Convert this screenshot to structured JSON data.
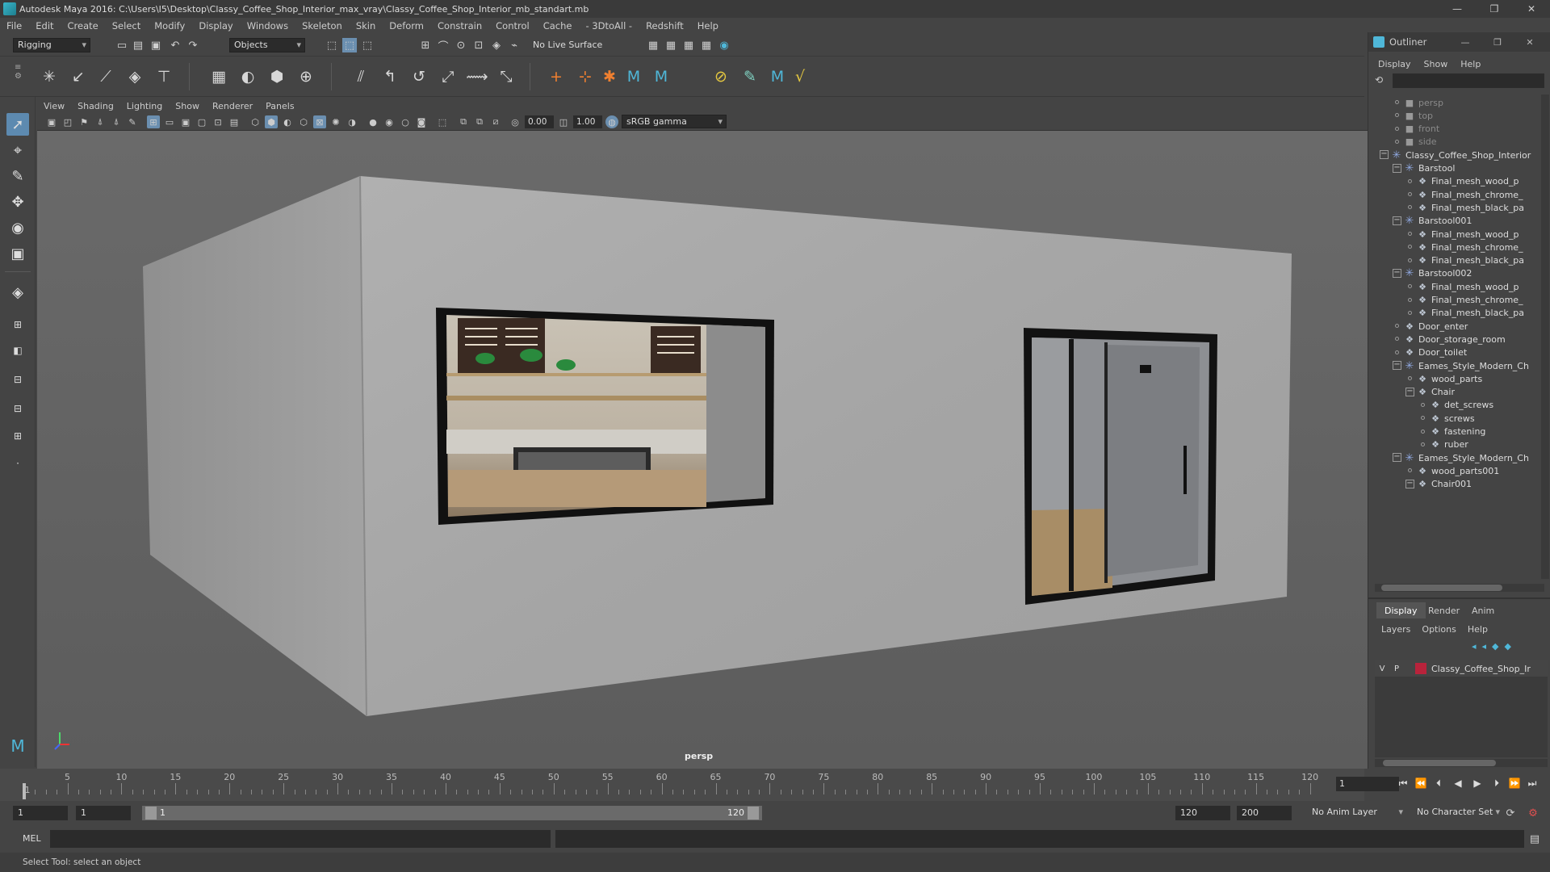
{
  "window": {
    "title": "Autodesk Maya 2016: C:\\Users\\I5\\Desktop\\Classy_Coffee_Shop_Interior_max_vray\\Classy_Coffee_Shop_Interior_mb_standart.mb",
    "minimize": "—",
    "restore": "❐",
    "close": "✕"
  },
  "menubar": [
    "File",
    "Edit",
    "Create",
    "Select",
    "Modify",
    "Display",
    "Windows",
    "Skeleton",
    "Skin",
    "Deform",
    "Constrain",
    "Control",
    "Cache",
    "- 3DtoAll -",
    "Redshift",
    "Help"
  ],
  "statusline": {
    "menuset": "Rigging",
    "selection_mask": "Objects",
    "live_surface": "No Live Surface"
  },
  "viewport": {
    "menu": [
      "View",
      "Shading",
      "Lighting",
      "Show",
      "Renderer",
      "Panels"
    ],
    "exposure": "0.00",
    "gamma": "1.00",
    "color_space": "sRGB gamma",
    "camera_label": "persp",
    "colors": {
      "wall": "#a8a8a8",
      "wall_side": "#9a9a9a",
      "window_frame": "#111111",
      "bg": "#616161"
    }
  },
  "outliner": {
    "title": "Outliner",
    "menu": [
      "Display",
      "Show",
      "Help"
    ],
    "items": [
      {
        "label": "persp",
        "type": "camera"
      },
      {
        "label": "top",
        "type": "camera"
      },
      {
        "label": "front",
        "type": "camera"
      },
      {
        "label": "side",
        "type": "camera"
      },
      {
        "label": "Classy_Coffee_Shop_Interior",
        "type": "group"
      },
      {
        "label": "Barstool",
        "type": "group"
      },
      {
        "label": "Final_mesh_wood_p",
        "type": "mesh"
      },
      {
        "label": "Final_mesh_chrome_",
        "type": "mesh"
      },
      {
        "label": "Final_mesh_black_pa",
        "type": "mesh"
      },
      {
        "label": "Barstool001",
        "type": "group"
      },
      {
        "label": "Final_mesh_wood_p",
        "type": "mesh"
      },
      {
        "label": "Final_mesh_chrome_",
        "type": "mesh"
      },
      {
        "label": "Final_mesh_black_pa",
        "type": "mesh"
      },
      {
        "label": "Barstool002",
        "type": "group"
      },
      {
        "label": "Final_mesh_wood_p",
        "type": "mesh"
      },
      {
        "label": "Final_mesh_chrome_",
        "type": "mesh"
      },
      {
        "label": "Final_mesh_black_pa",
        "type": "mesh"
      },
      {
        "label": "Door_enter",
        "type": "mesh"
      },
      {
        "label": "Door_storage_room",
        "type": "mesh"
      },
      {
        "label": "Door_toilet",
        "type": "mesh"
      },
      {
        "label": "Eames_Style_Modern_Ch",
        "type": "group"
      },
      {
        "label": "wood_parts",
        "type": "mesh"
      },
      {
        "label": "Chair",
        "type": "mesh"
      },
      {
        "label": "det_screws",
        "type": "mesh"
      },
      {
        "label": "screws",
        "type": "mesh"
      },
      {
        "label": "fastening",
        "type": "mesh"
      },
      {
        "label": "ruber",
        "type": "mesh"
      },
      {
        "label": "Eames_Style_Modern_Ch",
        "type": "group"
      },
      {
        "label": "wood_parts001",
        "type": "mesh"
      },
      {
        "label": "Chair001",
        "type": "mesh"
      }
    ]
  },
  "layer_editor": {
    "tabs": [
      "Display",
      "Render",
      "Anim"
    ],
    "menu": [
      "Layers",
      "Options",
      "Help"
    ],
    "layer": {
      "v": "V",
      "p": "P",
      "name": "Classy_Coffee_Shop_Ir",
      "color": "#b8233b"
    }
  },
  "timeline": {
    "start": 1,
    "end": 120,
    "current_frame": "1",
    "ticks": [
      5,
      10,
      15,
      20,
      25,
      30,
      35,
      40,
      45,
      50,
      55,
      60,
      65,
      70,
      75,
      80,
      85,
      90,
      95,
      100,
      105,
      110,
      115,
      120
    ],
    "first_tick": "1"
  },
  "range": {
    "start_field": "1",
    "playback_start": "1",
    "range_left": "1",
    "range_right": "120",
    "playback_end": "120",
    "end_field": "200",
    "anim_layer": "No Anim Layer",
    "character_set": "No Character Set"
  },
  "cmdline": {
    "label": "MEL"
  },
  "helpline": {
    "text": "Select Tool: select an object"
  }
}
